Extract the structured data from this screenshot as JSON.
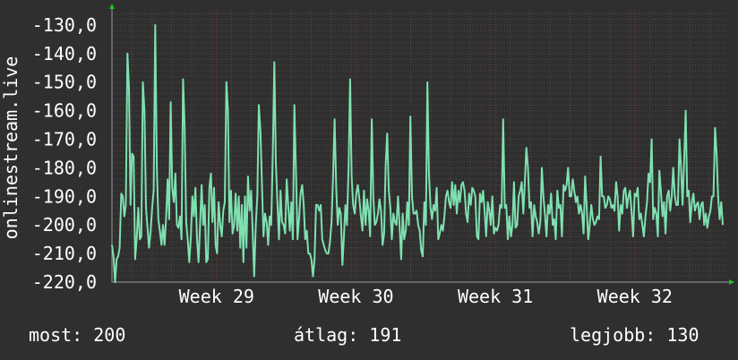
{
  "chart_data": {
    "type": "line",
    "ylabel": "onlinestream.live",
    "ylim": [
      -220,
      -125
    ],
    "y_ticks": [
      "-130,0",
      "-140,0",
      "-150,0",
      "-160,0",
      "-170,0",
      "-180,0",
      "-190,0",
      "-200,0",
      "-210,0",
      "-220,0"
    ],
    "y_tick_values": [
      -130,
      -140,
      -150,
      -160,
      -170,
      -180,
      -190,
      -200,
      -210,
      -220
    ],
    "x_labels": [
      "Week 29",
      "Week 30",
      "Week 31",
      "Week 32"
    ],
    "x_label_positions": [
      28.75,
      29.75,
      30.75,
      31.75
    ],
    "xlim": [
      28.0,
      32.4
    ],
    "grid": true,
    "line_color": "#7fe0b0",
    "grid_color": "#5a4848",
    "series": [
      {
        "values": [
          -207,
          -211,
          -220,
          -212,
          -211,
          -208,
          -189,
          -190,
          -197,
          -193,
          -140,
          -152,
          -193,
          -175,
          -176,
          -212,
          -205,
          -194,
          -205,
          -204,
          -150,
          -160,
          -194,
          -201,
          -208,
          -202,
          -194,
          -188,
          -130,
          -180,
          -198,
          -202,
          -207,
          -200,
          -207,
          -198,
          -184,
          -198,
          -157,
          -187,
          -192,
          -182,
          -200,
          -201,
          -197,
          -205,
          -149,
          -165,
          -199,
          -205,
          -213,
          -204,
          -190,
          -197,
          -187,
          -205,
          -213,
          -200,
          -186,
          -200,
          -193,
          -213,
          -212,
          -187,
          -182,
          -199,
          -187,
          -207,
          -210,
          -192,
          -200,
          -204,
          -195,
          -192,
          -150,
          -160,
          -199,
          -188,
          -203,
          -200,
          -189,
          -202,
          -190,
          -208,
          -193,
          -213,
          -190,
          -208,
          -183,
          -195,
          -188,
          -202,
          -218,
          -200,
          -190,
          -158,
          -167,
          -186,
          -204,
          -196,
          -199,
          -207,
          -197,
          -200,
          -175,
          -143,
          -178,
          -192,
          -205,
          -188,
          -199,
          -200,
          -203,
          -184,
          -193,
          -202,
          -192,
          -205,
          -158,
          -182,
          -205,
          -198,
          -189,
          -186,
          -193,
          -205,
          -202,
          -210,
          -210,
          -212,
          -218,
          -212,
          -193,
          -193,
          -195,
          -193,
          -205,
          -207,
          -209,
          -210,
          -210,
          -206,
          -199,
          -183,
          -163,
          -187,
          -200,
          -194,
          -196,
          -214,
          -204,
          -193,
          -200,
          -180,
          -149,
          -183,
          -193,
          -196,
          -189,
          -186,
          -191,
          -197,
          -202,
          -188,
          -200,
          -191,
          -195,
          -204,
          -163,
          -190,
          -200,
          -199,
          -196,
          -191,
          -195,
          -207,
          -203,
          -179,
          -168,
          -188,
          -194,
          -205,
          -196,
          -199,
          -200,
          -190,
          -200,
          -212,
          -196,
          -205,
          -202,
          -192,
          -200,
          -162,
          -190,
          -196,
          -196,
          -195,
          -200,
          -202,
          -209,
          -211,
          -192,
          -200,
          -150,
          -182,
          -194,
          -198,
          -193,
          -195,
          -187,
          -205,
          -203,
          -200,
          -202,
          -197,
          -190,
          -188,
          -192,
          -194,
          -185,
          -193,
          -186,
          -196,
          -188,
          -192,
          -186,
          -185,
          -188,
          -196,
          -199,
          -189,
          -193,
          -187,
          -188,
          -190,
          -204,
          -205,
          -189,
          -192,
          -188,
          -195,
          -204,
          -192,
          -195,
          -200,
          -190,
          -203,
          -201,
          -202,
          -200,
          -193,
          -194,
          -163,
          -194,
          -193,
          -205,
          -197,
          -204,
          -200,
          -185,
          -201,
          -200,
          -190,
          -188,
          -185,
          -196,
          -185,
          -173,
          -180,
          -194,
          -192,
          -204,
          -193,
          -197,
          -199,
          -203,
          -199,
          -180,
          -190,
          -196,
          -204,
          -193,
          -196,
          -189,
          -200,
          -198,
          -205,
          -188,
          -194,
          -193,
          -204,
          -186,
          -188,
          -186,
          -180,
          -190,
          -190,
          -184,
          -188,
          -192,
          -190,
          -196,
          -193,
          -196,
          -203,
          -183,
          -194,
          -205,
          -200,
          -193,
          -198,
          -200,
          -199,
          -197,
          -198,
          -176,
          -190,
          -190,
          -194,
          -193,
          -190,
          -191,
          -194,
          -193,
          -195,
          -185,
          -190,
          -202,
          -193,
          -196,
          -188,
          -187,
          -194,
          -190,
          -188,
          -195,
          -204,
          -189,
          -190,
          -187,
          -198,
          -196,
          -200,
          -204,
          -197,
          -192,
          -182,
          -185,
          -170,
          -198,
          -194,
          -196,
          -204,
          -181,
          -188,
          -197,
          -192,
          -203,
          -190,
          -188,
          -195,
          -190,
          -180,
          -190,
          -193,
          -193,
          -170,
          -180,
          -193,
          -178,
          -160,
          -190,
          -188,
          -199,
          -192,
          -189,
          -195,
          -193,
          -192,
          -198,
          -193,
          -192,
          -200,
          -196,
          -201,
          -197,
          -195,
          -190,
          -190,
          -166,
          -175,
          -190,
          -198,
          -192,
          -200
        ]
      }
    ]
  },
  "stats": {
    "now": "most: 200",
    "avg": "átlag: 191",
    "best": "legjobb: 130"
  }
}
